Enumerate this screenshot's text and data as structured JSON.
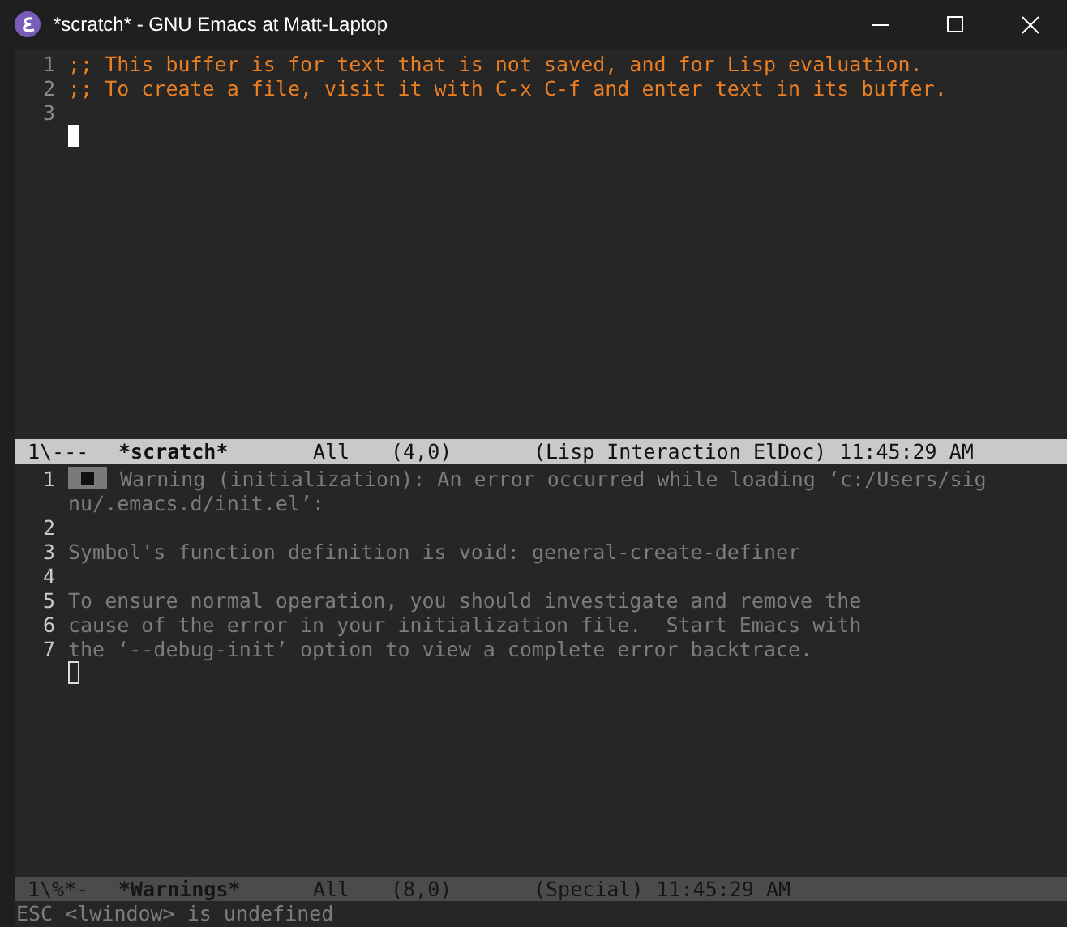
{
  "window": {
    "title": "*scratch* - GNU Emacs at Matt-Laptop"
  },
  "panes": [
    {
      "kind": "scratch",
      "lines": [
        {
          "number": "1",
          "text": ";; This buffer is for text that is not saved, and for Lisp evaluation."
        },
        {
          "number": "2",
          "text": ";; To create a file, visit it with C-x C-f and enter text in its buffer."
        },
        {
          "number": "3"
        }
      ],
      "mode_line": {
        "active": true,
        "status": "1\\---",
        "buffer": "*scratch*",
        "position": "All",
        "coords": "(4,0)",
        "modes": "(Lisp Interaction ElDoc)",
        "time": "11:45:29 AM"
      }
    },
    {
      "kind": "warnings",
      "lines": [
        {
          "number": "1",
          "marker": true,
          "text": "Warning (initialization): An error occurred while loading ‘c:/Users/sig",
          "continuation": "nu/.emacs.d/init.el’:"
        },
        {
          "number": "2"
        },
        {
          "number": "3",
          "text": "Symbol's function definition is void: general-create-definer"
        },
        {
          "number": "4"
        },
        {
          "number": "5",
          "text": "To ensure normal operation, you should investigate and remove the"
        },
        {
          "number": "6",
          "text": "cause of the error in your initialization file.  Start Emacs with"
        },
        {
          "number": "7",
          "text": "the ‘--debug-init’ option to view a complete error backtrace."
        }
      ],
      "mode_line": {
        "active": false,
        "status": "1\\%*-",
        "buffer": "*Warnings*",
        "position": "All",
        "coords": "(8,0)",
        "modes": "(Special)",
        "time": "11:45:29 AM"
      }
    }
  ],
  "echo_area": "ESC <lwindow> is undefined"
}
